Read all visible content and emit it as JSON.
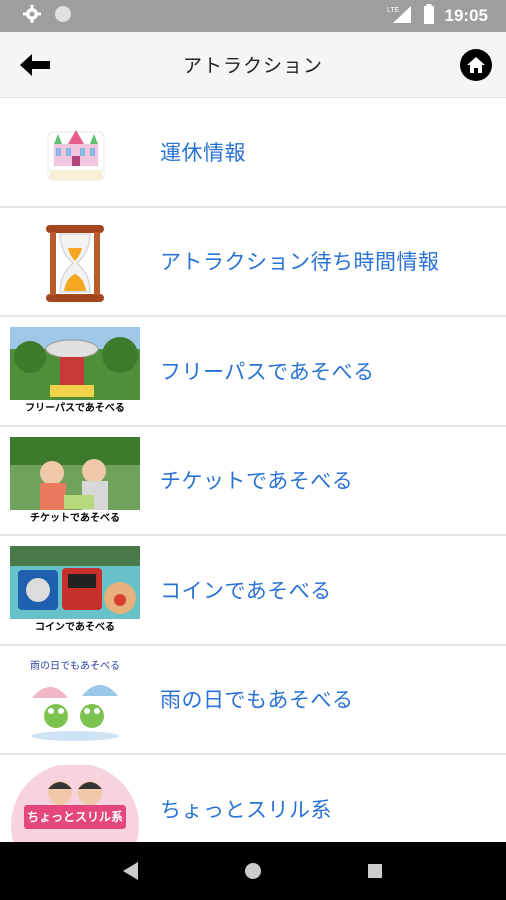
{
  "status_bar": {
    "time": "19:05",
    "network": "LTE"
  },
  "header": {
    "title": "アトラクション",
    "back_icon": "arrow-left-icon",
    "home_icon": "home-icon"
  },
  "items": [
    {
      "label": "運休情報",
      "icon": "amusement-park-castle-icon"
    },
    {
      "label": "アトラクション待ち時間情報",
      "icon": "hourglass-icon"
    },
    {
      "label": "フリーパスであそべる",
      "caption": "フリーパスであそべる"
    },
    {
      "label": "チケットであそべる",
      "caption": "チケットであそべる"
    },
    {
      "label": "コインであそべる",
      "caption": "コインであそべる"
    },
    {
      "label": "雨の日でもあそべる",
      "caption": "雨の日でもあそべる"
    },
    {
      "label": "ちょっとスリル系",
      "caption": "ちょっとスリル系"
    }
  ],
  "colors": {
    "label": "#2a73d6",
    "status_bar": "#9e9e9e",
    "nav_bar": "#000000"
  }
}
